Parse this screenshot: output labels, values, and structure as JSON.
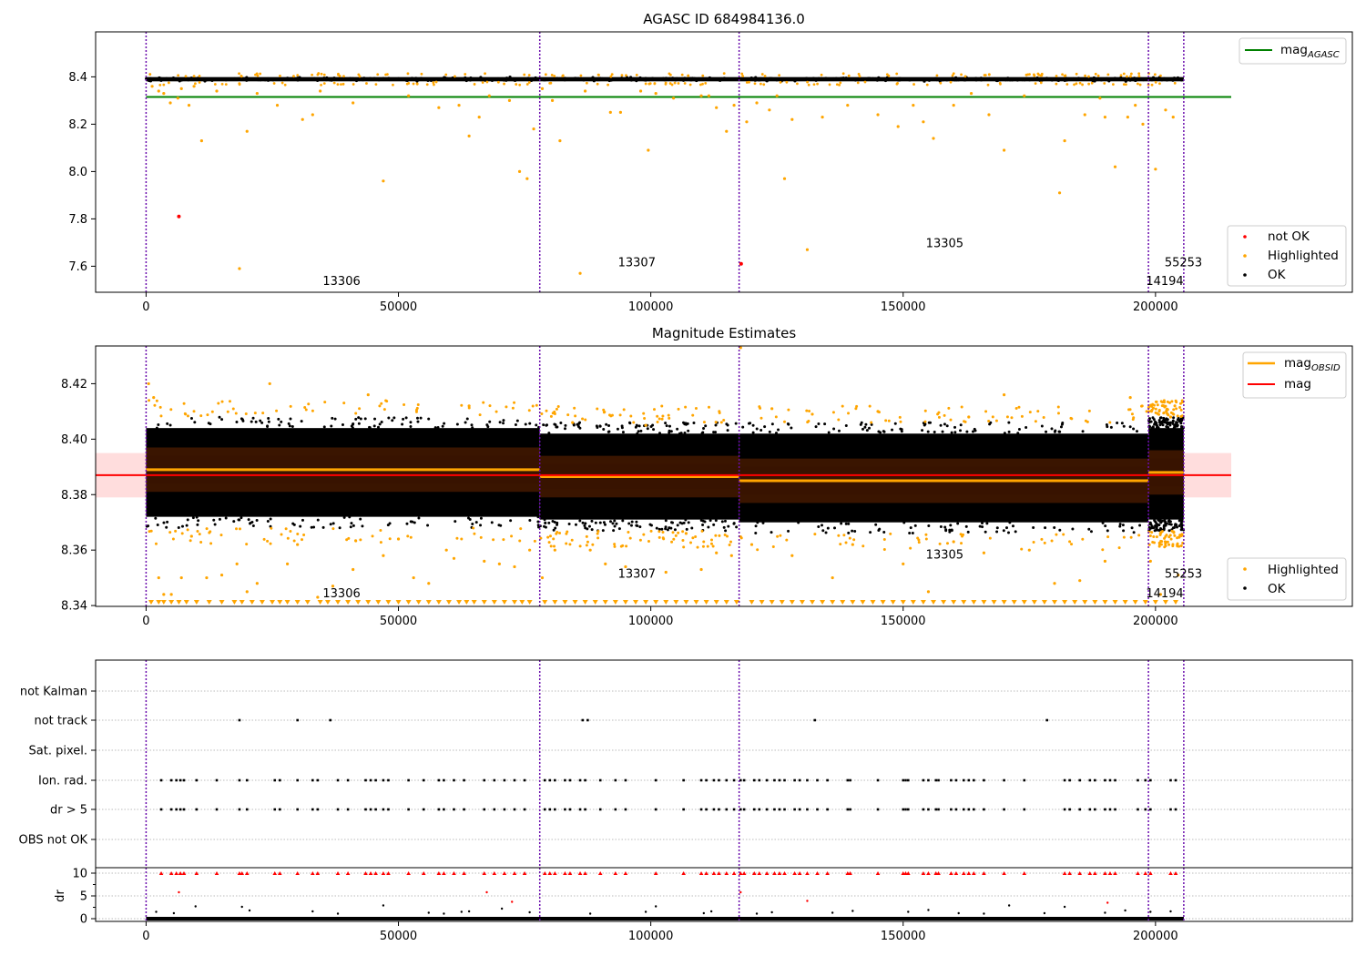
{
  "figure": {
    "obs_lines_x": [
      0,
      78000,
      117500,
      198600,
      205600
    ],
    "obs_line_color": "#6a0dad",
    "colors": {
      "ok": "#000000",
      "highlighted": "#ffa500",
      "not_ok": "#ff0000",
      "agasc": "#008000",
      "mag": "#ff0000",
      "mag_obsid": "#ffa500"
    },
    "x_ticks": [
      0,
      50000,
      100000,
      150000,
      200000
    ],
    "x_tick_labels": [
      "0",
      "50000",
      "100000",
      "150000",
      "200000"
    ]
  },
  "chart_data": [
    {
      "type": "scatter",
      "title": "AGASC ID 684984136.0",
      "xlim": [
        -10000,
        239000
      ],
      "ylim": [
        7.49,
        8.59
      ],
      "y_ticks": [
        7.6,
        7.8,
        8.0,
        8.2,
        8.4
      ],
      "y_tick_labels": [
        "7.6",
        "7.8",
        "8.0",
        "8.2",
        "8.4"
      ],
      "ok_band": {
        "x": [
          0,
          205600
        ],
        "y_center": 8.39,
        "half_width": 0.015
      },
      "mag_agasc": {
        "value": 8.315,
        "x": [
          0,
          215000
        ]
      },
      "not_ok_points": {
        "x": [
          6500,
          117900
        ],
        "y": [
          7.81,
          7.61
        ]
      },
      "highlighted_points": {
        "x": [
          1200,
          2500,
          3500,
          4800,
          6300,
          7000,
          8500,
          9500,
          11000,
          14000,
          18500,
          20000,
          22000,
          26000,
          31000,
          33000,
          34500,
          41000,
          47000,
          52000,
          58000,
          62000,
          64000,
          66000,
          68000,
          72000,
          74000,
          75500,
          76800,
          78500,
          80500,
          82000,
          86000,
          87000,
          92000,
          94000,
          98000,
          99500,
          101000,
          104500,
          110000,
          111500,
          113000,
          115000,
          116500,
          119000,
          121000,
          123500,
          125000,
          126500,
          128000,
          131000,
          134000,
          139000,
          145000,
          149000,
          152000,
          154000,
          156000,
          160000,
          163500,
          167000,
          170000,
          174000,
          181000,
          182000,
          186000,
          189000,
          190000,
          192000,
          194500,
          196000,
          197500,
          200000,
          202000,
          203500
        ],
        "y": [
          8.36,
          8.34,
          8.33,
          8.29,
          8.31,
          8.35,
          8.28,
          8.36,
          8.13,
          8.34,
          7.59,
          8.17,
          8.33,
          8.28,
          8.22,
          8.24,
          8.34,
          8.29,
          7.96,
          8.32,
          8.27,
          8.28,
          8.15,
          8.23,
          8.32,
          8.3,
          8.0,
          7.97,
          8.18,
          8.35,
          8.3,
          8.13,
          7.57,
          8.34,
          8.25,
          8.25,
          8.34,
          8.09,
          8.33,
          8.31,
          8.32,
          8.32,
          8.27,
          8.17,
          8.28,
          8.21,
          8.29,
          8.26,
          8.32,
          7.97,
          8.22,
          7.67,
          8.23,
          8.28,
          8.24,
          8.19,
          8.28,
          8.21,
          8.14,
          8.28,
          8.33,
          8.24,
          8.09,
          8.32,
          7.91,
          8.13,
          8.24,
          8.31,
          8.23,
          8.02,
          8.23,
          8.28,
          8.2,
          8.01,
          8.26,
          8.23
        ]
      },
      "annotations": [
        {
          "text": "13306",
          "x": 35000,
          "y": 7.52
        },
        {
          "text": "13307",
          "x": 93500,
          "y": 7.6
        },
        {
          "text": "13305",
          "x": 154500,
          "y": 7.68
        },
        {
          "text": "55253",
          "x": 201800,
          "y": 7.6
        },
        {
          "text": "14194",
          "x": 198100,
          "y": 7.52
        }
      ],
      "legend_upper": {
        "placement": "top-right",
        "entries": [
          {
            "name": "mag",
            "sub": "AGASC"
          }
        ]
      },
      "legend_lower": {
        "placement": "bottom-right",
        "entries": [
          "not OK",
          "Highlighted",
          "OK"
        ]
      }
    },
    {
      "type": "scatter",
      "title": "Magnitude Estimates",
      "xlim": [
        -10000,
        239000
      ],
      "ylim": [
        8.3397,
        8.4336
      ],
      "y_ticks": [
        8.34,
        8.36,
        8.38,
        8.4,
        8.42
      ],
      "y_tick_labels": [
        "8.34",
        "8.36",
        "8.38",
        "8.40",
        "8.42"
      ],
      "mag": {
        "value": 8.387,
        "band": [
          8.379,
          8.395
        ],
        "x": [
          -10000,
          215000
        ]
      },
      "mag_obsid_segments": [
        {
          "x": [
            0,
            78000
          ],
          "value": 8.389,
          "band": [
            8.381,
            8.397
          ],
          "dense": [
            8.368,
            8.408
          ]
        },
        {
          "x": [
            78000,
            117500
          ],
          "value": 8.3865,
          "band": [
            8.379,
            8.394
          ],
          "dense": [
            8.367,
            8.406
          ]
        },
        {
          "x": [
            117500,
            198600
          ],
          "value": 8.385,
          "band": [
            8.377,
            8.393
          ],
          "dense": [
            8.366,
            8.406
          ]
        },
        {
          "x": [
            198600,
            205600
          ],
          "value": 8.388,
          "band": [
            8.38,
            8.396
          ],
          "dense": [
            8.367,
            8.408
          ]
        }
      ],
      "highlighted_points": {
        "x": [
          500,
          1500,
          2500,
          3500,
          5000,
          7000,
          9000,
          12000,
          15000,
          18000,
          20000,
          22000,
          24500,
          28000,
          30000,
          34000,
          37000,
          41000,
          44000,
          47000,
          50000,
          53000,
          56000,
          59500,
          61000,
          64000,
          67000,
          70000,
          73000,
          76000,
          78500,
          81000,
          84500,
          88000,
          91000,
          95000,
          99000,
          103000,
          107000,
          110000,
          113000,
          116000,
          117800,
          120000,
          124000,
          128000,
          132000,
          136000,
          140000,
          145000,
          150000,
          155000,
          160000,
          163000,
          166000,
          170000,
          175000,
          180000,
          185000,
          190000,
          195000,
          199000,
          201000,
          203000,
          204500
        ],
        "y": [
          8.42,
          8.415,
          8.35,
          8.344,
          8.344,
          8.35,
          8.365,
          8.35,
          8.351,
          8.355,
          8.345,
          8.348,
          8.42,
          8.355,
          8.362,
          8.343,
          8.347,
          8.353,
          8.416,
          8.358,
          8.364,
          8.35,
          8.348,
          8.36,
          8.357,
          8.412,
          8.356,
          8.355,
          8.354,
          8.36,
          8.35,
          8.36,
          8.406,
          8.36,
          8.355,
          8.354,
          8.405,
          8.352,
          8.366,
          8.353,
          8.359,
          8.358,
          8.433,
          8.362,
          8.411,
          8.358,
          8.409,
          8.35,
          8.362,
          8.41,
          8.355,
          8.345,
          8.363,
          8.408,
          8.359,
          8.416,
          8.36,
          8.348,
          8.349,
          8.356,
          8.415,
          8.356,
          8.344,
          8.408,
          8.351
        ]
      },
      "floor_markers_x": [
        1000,
        2500,
        3500,
        5000,
        6500,
        8000,
        10000,
        12500,
        15000,
        17500,
        19000,
        21000,
        23000,
        25000,
        26500,
        28000,
        30000,
        32000,
        34500,
        36000,
        38000,
        40000,
        42000,
        44000,
        46000,
        48000,
        50000,
        52000,
        54000,
        56000,
        58000,
        60000,
        62000,
        63500,
        65000,
        67000,
        69000,
        71000,
        73000,
        74500,
        76000,
        79000,
        81000,
        83000,
        85000,
        87000,
        89000,
        91000,
        93000,
        95000,
        97000,
        99000,
        101000,
        103000,
        105000,
        107000,
        109000,
        111000,
        113000,
        115000,
        117000,
        120000,
        122000,
        124000,
        126000,
        128000,
        130000,
        132000,
        134000,
        136000,
        138000,
        140000,
        142000,
        144000,
        146000,
        148000,
        150000,
        152000,
        154000,
        156000,
        158000,
        160000,
        162000,
        164000,
        166000,
        168000,
        170000,
        172000,
        174000,
        176000,
        178000,
        180000,
        182000,
        184000,
        186000,
        188000,
        190000,
        192000,
        194000,
        196000,
        198000,
        200000,
        202000,
        204000
      ],
      "annotations": [
        {
          "text": "13306",
          "x": 35000,
          "y": 8.343
        },
        {
          "text": "13307",
          "x": 93500,
          "y": 8.35
        },
        {
          "text": "13305",
          "x": 154500,
          "y": 8.357
        },
        {
          "text": "55253",
          "x": 201800,
          "y": 8.35
        },
        {
          "text": "14194",
          "x": 198100,
          "y": 8.343
        }
      ],
      "legend_upper": {
        "placement": "top-right",
        "entries": [
          {
            "name": "mag",
            "sub": "OBSID"
          },
          {
            "name": "mag",
            "sub": ""
          }
        ]
      },
      "legend_lower": {
        "placement": "bottom-right",
        "entries": [
          "Highlighted",
          "OK"
        ]
      }
    },
    {
      "type": "scatter",
      "xlim": [
        -10000,
        239000
      ],
      "categories": [
        "not Kalman",
        "not track",
        "Sat. pixel.",
        "Ion. rad.",
        "dr > 5",
        "OBS not OK"
      ],
      "flag_points": [
        {
          "category": "not track",
          "x": [
            18500,
            30000,
            36500,
            86500,
            87500,
            132500,
            178500
          ]
        },
        {
          "category": "Ion. rad.",
          "x": [
            3000,
            5000,
            6000,
            6800,
            7500,
            10000,
            14000,
            18500,
            20000,
            25500,
            26500,
            30000,
            33000,
            34000,
            38000,
            40000,
            43500,
            44500,
            45500,
            47000,
            48000,
            52000,
            55000,
            58000,
            59000,
            61000,
            63000,
            67000,
            69000,
            71000,
            73000,
            75000,
            79000,
            80000,
            81000,
            83000,
            84000,
            86000,
            87000,
            90000,
            93000,
            95000,
            101000,
            106500,
            110000,
            111000,
            112500,
            113500,
            115000,
            116500,
            117800,
            118500,
            120500,
            121500,
            123000,
            124500,
            125500,
            126500,
            128500,
            129500,
            131000,
            133000,
            135000,
            139000,
            139500,
            145000,
            150000,
            150500,
            151000,
            154000,
            155000,
            156500,
            157000,
            159500,
            160500,
            162000,
            163000,
            164000,
            166000,
            170000,
            174000,
            182000,
            183000,
            185000,
            187000,
            188000,
            190000,
            191000,
            192000,
            196500,
            198000,
            199000,
            203000,
            204000
          ]
        },
        {
          "category": "dr > 5",
          "x": [
            3000,
            5000,
            6000,
            6800,
            7500,
            10000,
            14000,
            18500,
            20000,
            25500,
            26500,
            30000,
            33000,
            34000,
            38000,
            40000,
            43500,
            44500,
            45500,
            47000,
            48000,
            52000,
            55000,
            58000,
            59000,
            61000,
            63000,
            67000,
            69000,
            71000,
            73000,
            75000,
            79000,
            80000,
            81000,
            83000,
            84000,
            86000,
            87000,
            90000,
            93000,
            95000,
            101000,
            106500,
            110000,
            111000,
            112500,
            113500,
            115000,
            116500,
            117800,
            118500,
            120500,
            121500,
            123000,
            124500,
            125500,
            126500,
            128500,
            129500,
            131000,
            133000,
            135000,
            139000,
            139500,
            145000,
            150000,
            150500,
            151000,
            154000,
            155000,
            156500,
            157000,
            159500,
            160500,
            162000,
            163000,
            164000,
            166000,
            170000,
            174000,
            182000,
            183000,
            185000,
            187000,
            188000,
            190000,
            191000,
            192000,
            196500,
            198000,
            199000,
            203000,
            204000
          ]
        }
      ],
      "dr_panel": {
        "ylabel": "dr",
        "ylim": [
          -0.6,
          10.6
        ],
        "y_ticks": [
          0,
          5,
          10
        ],
        "y_tick_labels": [
          "0",
          "5",
          "10"
        ],
        "capped_points_x": [
          3000,
          5000,
          6000,
          6800,
          7500,
          10000,
          14000,
          18500,
          19000,
          20000,
          25500,
          26500,
          30000,
          33000,
          34000,
          38000,
          40000,
          43500,
          44500,
          45500,
          47000,
          48000,
          52000,
          55000,
          58000,
          59000,
          61000,
          63000,
          67000,
          69000,
          71000,
          73000,
          75000,
          79000,
          80000,
          81000,
          83000,
          84000,
          86000,
          87000,
          90000,
          93000,
          95000,
          101000,
          106500,
          110000,
          111000,
          112500,
          113500,
          115000,
          116500,
          117800,
          118500,
          120500,
          121500,
          123000,
          124500,
          125500,
          126500,
          128500,
          129500,
          131000,
          133000,
          135000,
          139000,
          139500,
          145000,
          150000,
          150500,
          151000,
          154000,
          155000,
          156500,
          157000,
          159500,
          160500,
          162000,
          163000,
          164000,
          166000,
          170000,
          174000,
          182000,
          183000,
          185000,
          187000,
          188000,
          190000,
          191000,
          192000,
          196500,
          198000,
          199000,
          203000,
          204000
        ],
        "red_points": {
          "x": [
            6500,
            67500,
            72500,
            117800,
            131000,
            190500
          ],
          "y": [
            5.8,
            5.8,
            3.7,
            5.8,
            3.9,
            3.5
          ]
        },
        "black_points": {
          "x": [
            2000,
            5500,
            9800,
            19000,
            20500,
            33000,
            38000,
            47000,
            56000,
            59000,
            62500,
            64000,
            70500,
            76000,
            88000,
            99000,
            101000,
            110500,
            112000,
            121000,
            124000,
            136000,
            140000,
            151000,
            155000,
            161000,
            166000,
            171000,
            178000,
            182000,
            190000,
            194000,
            199000,
            203000
          ],
          "y": [
            1.5,
            1.2,
            2.7,
            2.6,
            1.8,
            1.6,
            1.1,
            2.9,
            1.3,
            1.1,
            1.5,
            1.6,
            2.2,
            1.4,
            1.1,
            1.5,
            2.7,
            1.2,
            1.6,
            1.1,
            1.4,
            1.3,
            1.7,
            1.5,
            1.9,
            1.2,
            1.1,
            2.9,
            1.2,
            2.6,
            1.3,
            1.8,
            1.5,
            1.6
          ]
        }
      }
    }
  ]
}
